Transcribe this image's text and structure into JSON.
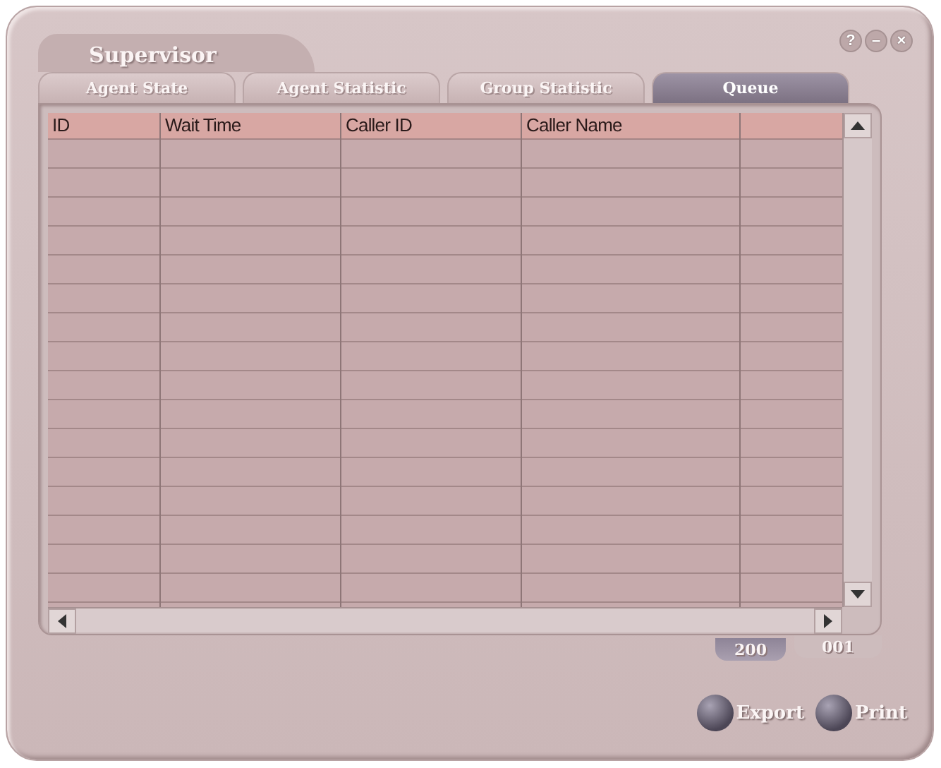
{
  "window": {
    "title": "Supervisor",
    "controls": [
      "?",
      "–",
      "×"
    ]
  },
  "tabs": [
    {
      "label": "Agent State",
      "selected": false
    },
    {
      "label": "Agent Statistic",
      "selected": false
    },
    {
      "label": "Group Statistic",
      "selected": false
    },
    {
      "label": "Queue",
      "selected": true
    }
  ],
  "table": {
    "columns": [
      "ID",
      "Wait Time",
      "Caller ID",
      "Caller Name"
    ]
  },
  "bottom_tabs": [
    {
      "label": "200",
      "selected": true
    },
    {
      "label": "001",
      "selected": false
    }
  ],
  "buttons": [
    "Export",
    "Print"
  ]
}
